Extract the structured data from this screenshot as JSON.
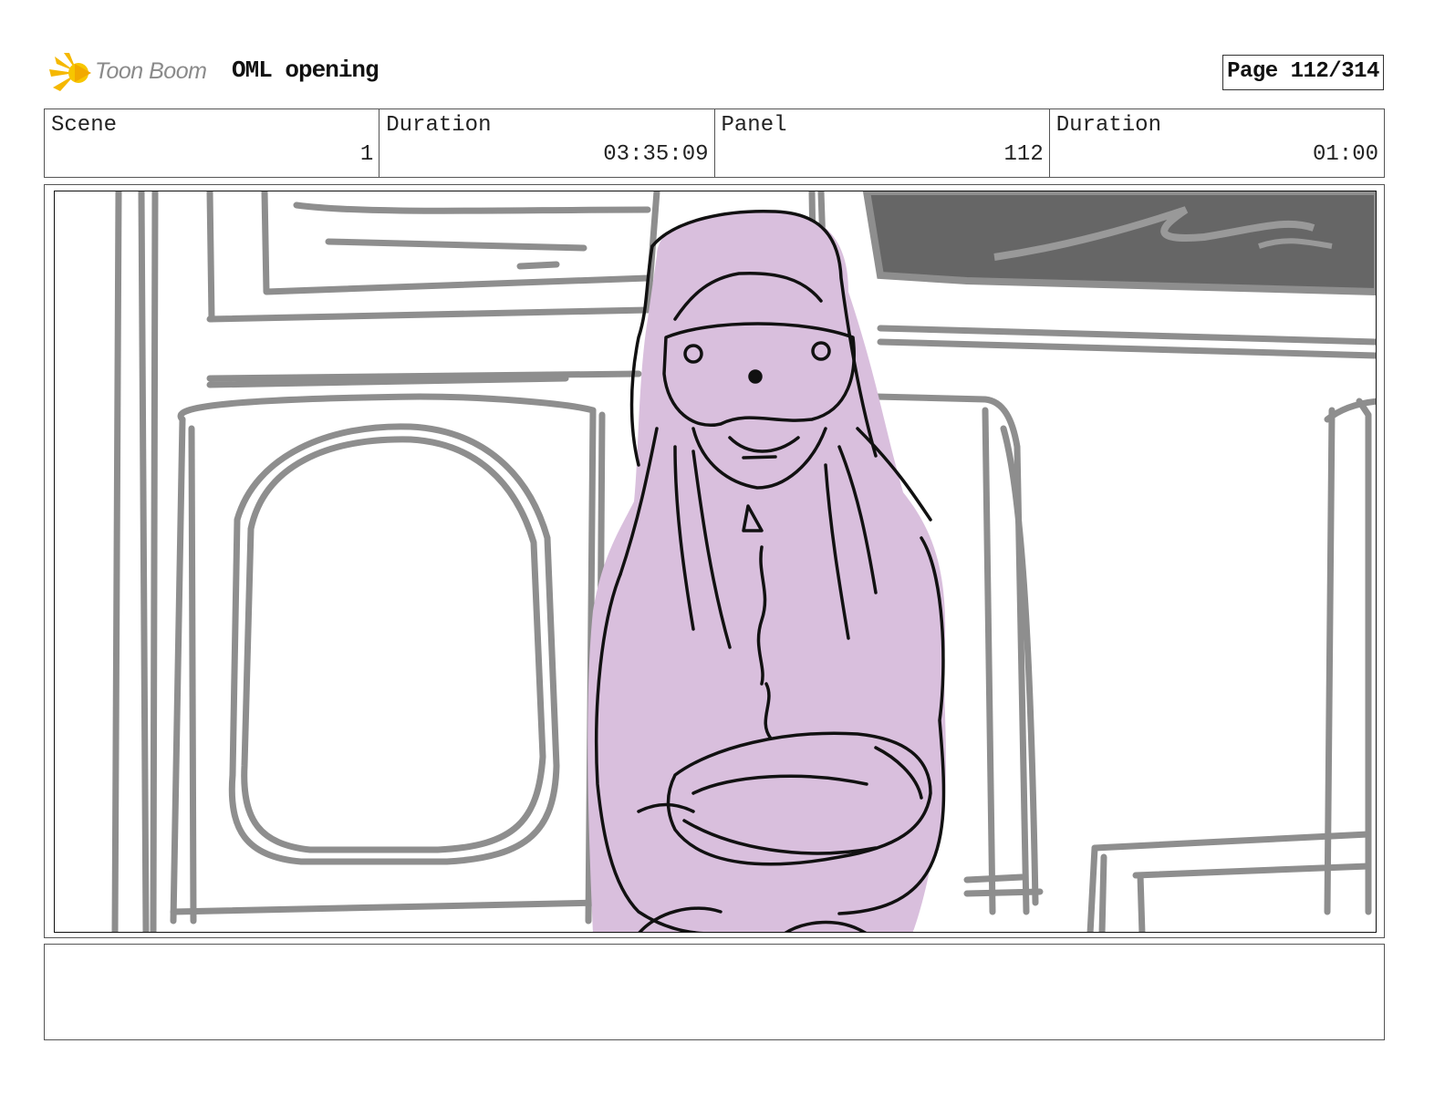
{
  "header": {
    "logo_text": "Toon Boom",
    "project_title": "OML opening",
    "page_label": "Page 112/314"
  },
  "info": [
    {
      "label": "Scene",
      "value": "1"
    },
    {
      "label": "Duration",
      "value": "03:35:09"
    },
    {
      "label": "Panel",
      "value": "112"
    },
    {
      "label": "Duration",
      "value": "01:00"
    }
  ],
  "notes": {
    "text": ""
  },
  "colors": {
    "accent_logo": "#f5b800",
    "sketch_gray": "#8e8e8e",
    "character_fill": "#d9bfdd",
    "dark_panel": "#666666"
  }
}
